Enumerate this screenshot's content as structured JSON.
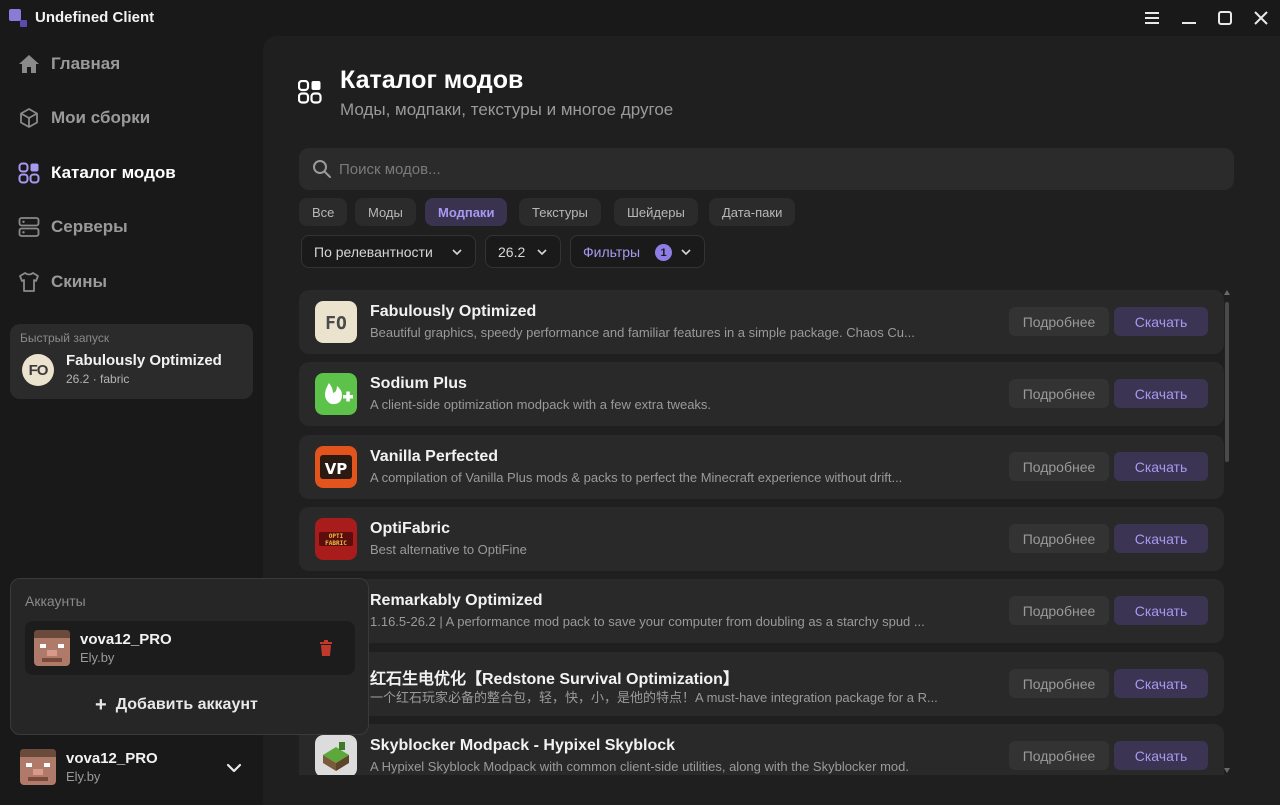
{
  "app": {
    "title": "Undefined Client",
    "accent_color": "#8f7de6"
  },
  "window_controls": [
    "menu-icon",
    "minimize-icon",
    "maximize-icon",
    "close-icon"
  ],
  "sidebar": {
    "items": [
      {
        "label": "Главная",
        "icon": "home-icon",
        "active": false
      },
      {
        "label": "Мои сборки",
        "icon": "cube-icon",
        "active": false
      },
      {
        "label": "Каталог модов",
        "icon": "grid-icon",
        "active": true
      },
      {
        "label": "Серверы",
        "icon": "server-icon",
        "active": false
      },
      {
        "label": "Скины",
        "icon": "shirt-icon",
        "active": false
      }
    ],
    "quick_launch": {
      "heading": "Быстрый запуск",
      "icon_text": "FO",
      "name": "Fabulously Optimized",
      "meta": "26.2 · fabric"
    }
  },
  "accounts_panel": {
    "heading": "Аккаунты",
    "account": {
      "name": "vova12_PRO",
      "provider": "Ely.by"
    },
    "add_label": "Добавить аккаунт"
  },
  "current_account": {
    "name": "vova12_PRO",
    "provider": "Ely.by"
  },
  "main": {
    "title": "Каталог модов",
    "subtitle": "Моды, модпаки, текстуры и многое другое",
    "search": {
      "placeholder": "Поиск модов...",
      "value": ""
    },
    "tabs": [
      {
        "label": "Все",
        "active": false
      },
      {
        "label": "Моды",
        "active": false
      },
      {
        "label": "Модпаки",
        "active": true
      },
      {
        "label": "Текстуры",
        "active": false
      },
      {
        "label": "Шейдеры",
        "active": false
      },
      {
        "label": "Дата-паки",
        "active": false
      }
    ],
    "sort": {
      "value": "По релевантности"
    },
    "version": {
      "value": "26.2"
    },
    "filters": {
      "label": "Фильтры",
      "count": "1"
    },
    "button_labels": {
      "details": "Подробнее",
      "download": "Скачать"
    },
    "modpacks": [
      {
        "title": "Fabulously Optimized",
        "description": "Beautiful graphics, speedy performance and familiar features in a simple package. Chaos Cu...",
        "icon": "fo-logo"
      },
      {
        "title": "Sodium Plus",
        "description": "A client-side optimization modpack with a few extra tweaks.",
        "icon": "sodium-plus-logo"
      },
      {
        "title": "Vanilla Perfected",
        "description": "A compilation of Vanilla Plus mods & packs to perfect the Minecraft experience without drift...",
        "icon": "vp-logo"
      },
      {
        "title": "OptiFabric",
        "description": "Best alternative to OptiFine",
        "icon": "optifabric-logo"
      },
      {
        "title": "Remarkably Optimized",
        "description": "1.16.5-26.2 | A performance mod pack to save your computer from doubling as a starchy spud ...",
        "icon": "potato-logo"
      },
      {
        "title": "红石生电优化【Redstone Survival Optimization】",
        "description": "一个红石玩家必备的整合包，轻，快，小，是他的特点！A must-have integration package for a R...",
        "icon": "redstone-logo"
      },
      {
        "title": "Skyblocker Modpack - Hypixel Skyblock",
        "description": "A Hypixel Skyblock Modpack with common client-side utilities, along with the Skyblocker mod.",
        "icon": "skyblock-island-logo"
      }
    ]
  }
}
